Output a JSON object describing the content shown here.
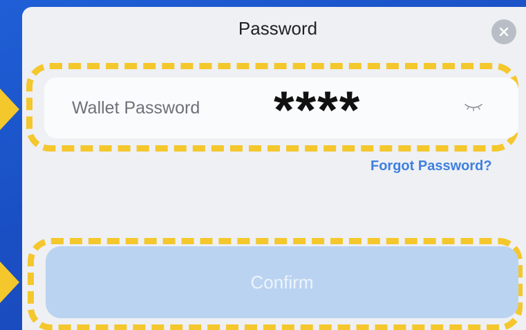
{
  "dialog": {
    "title": "Password",
    "close_icon": "close-icon"
  },
  "password_field": {
    "placeholder": "Wallet Password",
    "value": "****",
    "toggle_icon": "eye-closed-icon"
  },
  "forgot_link": "Forgot Password?",
  "confirm_label": "Confirm",
  "colors": {
    "background": "#1f5fd6",
    "sheet": "#eef0f3",
    "highlight": "#f4c72c",
    "link": "#3f7fe0",
    "confirm_disabled": "#bad3f1"
  }
}
